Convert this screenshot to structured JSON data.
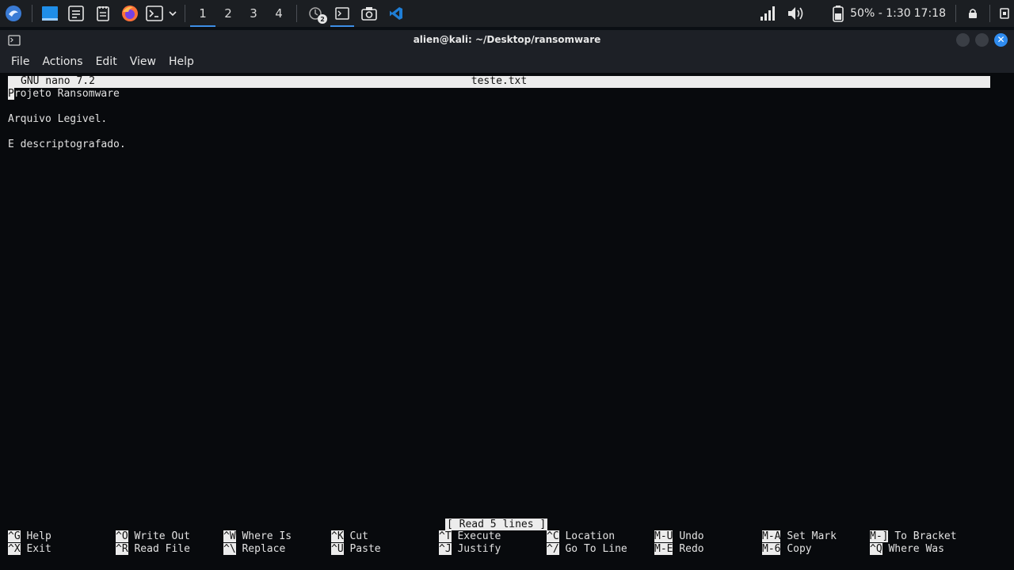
{
  "panel": {
    "workspaces": [
      "1",
      "2",
      "3",
      "4"
    ],
    "active_workspace": "1",
    "task_badge": "2",
    "battery": "50% - 1:30",
    "clock": "17:18",
    "accent": "#3d8ee6"
  },
  "window": {
    "title": "alien@kali: ~/Desktop/ransomware",
    "close_glyph": "✕"
  },
  "menu": [
    "File",
    "Actions",
    "Edit",
    "View",
    "Help"
  ],
  "nano": {
    "version": "GNU nano 7.2",
    "filename": "teste.txt",
    "lines": [
      {
        "first": "P",
        "rest": "rojeto Ransomware"
      },
      {
        "first": "",
        "rest": ""
      },
      {
        "first": "",
        "rest": "Arquivo Legivel."
      },
      {
        "first": "",
        "rest": ""
      },
      {
        "first": "",
        "rest": "E descriptografado."
      }
    ],
    "status": "[ Read 5 lines ]",
    "shortcuts": [
      {
        "key": "^G",
        "label": "Help"
      },
      {
        "key": "^X",
        "label": "Exit"
      },
      {
        "key": "^O",
        "label": "Write Out"
      },
      {
        "key": "^R",
        "label": "Read File"
      },
      {
        "key": "^W",
        "label": "Where Is"
      },
      {
        "key": "^\\",
        "label": "Replace"
      },
      {
        "key": "^K",
        "label": "Cut"
      },
      {
        "key": "^U",
        "label": "Paste"
      },
      {
        "key": "^T",
        "label": "Execute"
      },
      {
        "key": "^J",
        "label": "Justify"
      },
      {
        "key": "^C",
        "label": "Location"
      },
      {
        "key": "^/",
        "label": "Go To Line"
      },
      {
        "key": "M-U",
        "label": "Undo"
      },
      {
        "key": "M-E",
        "label": "Redo"
      },
      {
        "key": "M-A",
        "label": "Set Mark"
      },
      {
        "key": "M-6",
        "label": "Copy"
      },
      {
        "key": "M-]",
        "label": "To Bracket"
      },
      {
        "key": "^Q",
        "label": "Where Was"
      }
    ]
  }
}
